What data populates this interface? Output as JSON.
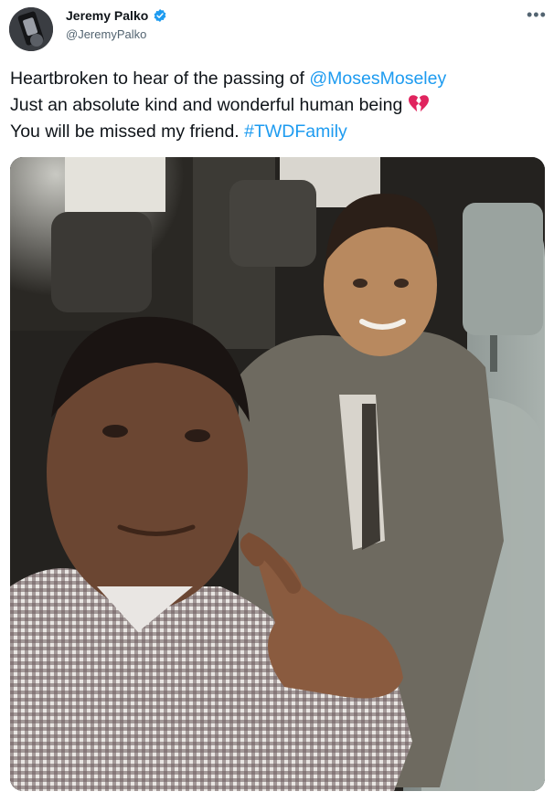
{
  "user": {
    "display_name": "Jeremy Palko",
    "handle": "@JeremyPalko",
    "verified": true
  },
  "more_icon": "more-icon",
  "tweet": {
    "line1_text": "Heartbroken to hear of the passing of ",
    "mention": "@MosesMoseley",
    "line2_text": "Just an absolute kind and wonderful human being",
    "line3_text": "You will be missed my friend. ",
    "hashtag": "#TWDFamily",
    "emoji": "broken-heart-icon"
  },
  "colors": {
    "link": "#1d9bf0",
    "text": "#0f1419",
    "secondary": "#536471",
    "verified": "#1d9bf0",
    "broken_heart": "#e0245e"
  },
  "media": {
    "type": "photo",
    "icon": "photo-image"
  }
}
